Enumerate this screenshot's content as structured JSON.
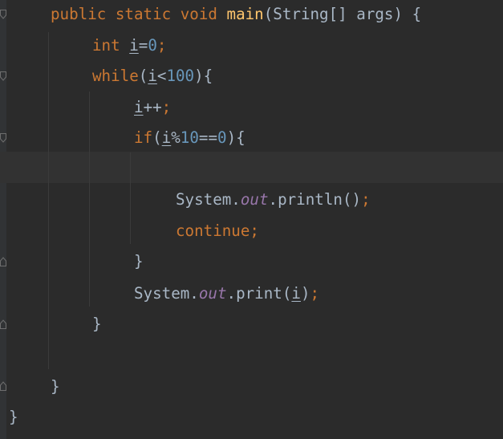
{
  "editor": {
    "colors": {
      "background": "#2b2b2b",
      "keyword": "#cc7832",
      "method": "#ffc66d",
      "number": "#6897bb",
      "field": "#9876aa",
      "text": "#a9b7c6"
    },
    "lines": {
      "l1": {
        "kw1": "public",
        "kw2": "static",
        "kw3": "void",
        "method": "main",
        "rest": "(String[] args) {"
      },
      "l2": {
        "type": "int",
        "var": "i",
        "eq": "=",
        "num": "0",
        "semi": ";"
      },
      "l3": {
        "kw": "while",
        "open": "(",
        "var": "i",
        "op": "<",
        "num": "100",
        "close": "){"
      },
      "l4": {
        "var": "i",
        "op": "++",
        "semi": ";"
      },
      "l5": {
        "kw": "if",
        "open": "(",
        "var": "i",
        "op1": "%",
        "num1": "10",
        "op2": "==",
        "num2": "0",
        "close": "){"
      },
      "l6": {
        "text": ""
      },
      "l7": {
        "cls": "System.",
        "field": "out",
        "call": ".println()",
        "semi": ";"
      },
      "l8": {
        "kw": "continue",
        "semi": ";"
      },
      "l9": {
        "brace": "}"
      },
      "l10": {
        "cls": "System.",
        "field": "out",
        "call": ".print(",
        "var": "i",
        "close": ")",
        "semi": ";"
      },
      "l11": {
        "brace": "}"
      },
      "l12": {
        "text": ""
      },
      "l13": {
        "brace": "}"
      },
      "l14": {
        "brace": "}"
      }
    }
  }
}
